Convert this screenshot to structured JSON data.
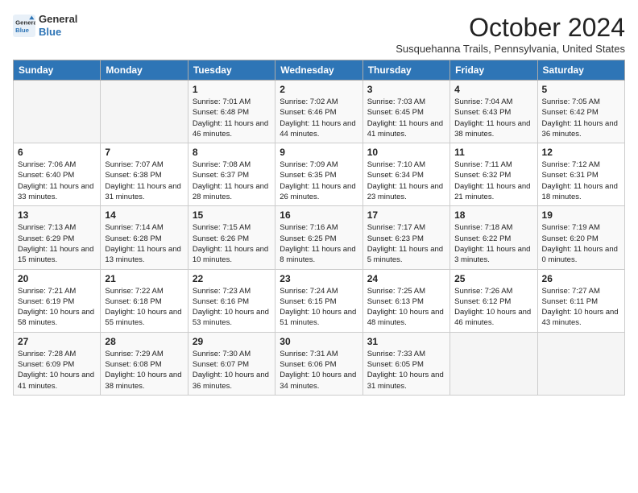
{
  "logo": {
    "line1": "General",
    "line2": "Blue"
  },
  "title": "October 2024",
  "subtitle": "Susquehanna Trails, Pennsylvania, United States",
  "days_of_week": [
    "Sunday",
    "Monday",
    "Tuesday",
    "Wednesday",
    "Thursday",
    "Friday",
    "Saturday"
  ],
  "weeks": [
    [
      {
        "day": "",
        "info": ""
      },
      {
        "day": "",
        "info": ""
      },
      {
        "day": "1",
        "info": "Sunrise: 7:01 AM\nSunset: 6:48 PM\nDaylight: 11 hours and 46 minutes."
      },
      {
        "day": "2",
        "info": "Sunrise: 7:02 AM\nSunset: 6:46 PM\nDaylight: 11 hours and 44 minutes."
      },
      {
        "day": "3",
        "info": "Sunrise: 7:03 AM\nSunset: 6:45 PM\nDaylight: 11 hours and 41 minutes."
      },
      {
        "day": "4",
        "info": "Sunrise: 7:04 AM\nSunset: 6:43 PM\nDaylight: 11 hours and 38 minutes."
      },
      {
        "day": "5",
        "info": "Sunrise: 7:05 AM\nSunset: 6:42 PM\nDaylight: 11 hours and 36 minutes."
      }
    ],
    [
      {
        "day": "6",
        "info": "Sunrise: 7:06 AM\nSunset: 6:40 PM\nDaylight: 11 hours and 33 minutes."
      },
      {
        "day": "7",
        "info": "Sunrise: 7:07 AM\nSunset: 6:38 PM\nDaylight: 11 hours and 31 minutes."
      },
      {
        "day": "8",
        "info": "Sunrise: 7:08 AM\nSunset: 6:37 PM\nDaylight: 11 hours and 28 minutes."
      },
      {
        "day": "9",
        "info": "Sunrise: 7:09 AM\nSunset: 6:35 PM\nDaylight: 11 hours and 26 minutes."
      },
      {
        "day": "10",
        "info": "Sunrise: 7:10 AM\nSunset: 6:34 PM\nDaylight: 11 hours and 23 minutes."
      },
      {
        "day": "11",
        "info": "Sunrise: 7:11 AM\nSunset: 6:32 PM\nDaylight: 11 hours and 21 minutes."
      },
      {
        "day": "12",
        "info": "Sunrise: 7:12 AM\nSunset: 6:31 PM\nDaylight: 11 hours and 18 minutes."
      }
    ],
    [
      {
        "day": "13",
        "info": "Sunrise: 7:13 AM\nSunset: 6:29 PM\nDaylight: 11 hours and 15 minutes."
      },
      {
        "day": "14",
        "info": "Sunrise: 7:14 AM\nSunset: 6:28 PM\nDaylight: 11 hours and 13 minutes."
      },
      {
        "day": "15",
        "info": "Sunrise: 7:15 AM\nSunset: 6:26 PM\nDaylight: 11 hours and 10 minutes."
      },
      {
        "day": "16",
        "info": "Sunrise: 7:16 AM\nSunset: 6:25 PM\nDaylight: 11 hours and 8 minutes."
      },
      {
        "day": "17",
        "info": "Sunrise: 7:17 AM\nSunset: 6:23 PM\nDaylight: 11 hours and 5 minutes."
      },
      {
        "day": "18",
        "info": "Sunrise: 7:18 AM\nSunset: 6:22 PM\nDaylight: 11 hours and 3 minutes."
      },
      {
        "day": "19",
        "info": "Sunrise: 7:19 AM\nSunset: 6:20 PM\nDaylight: 11 hours and 0 minutes."
      }
    ],
    [
      {
        "day": "20",
        "info": "Sunrise: 7:21 AM\nSunset: 6:19 PM\nDaylight: 10 hours and 58 minutes."
      },
      {
        "day": "21",
        "info": "Sunrise: 7:22 AM\nSunset: 6:18 PM\nDaylight: 10 hours and 55 minutes."
      },
      {
        "day": "22",
        "info": "Sunrise: 7:23 AM\nSunset: 6:16 PM\nDaylight: 10 hours and 53 minutes."
      },
      {
        "day": "23",
        "info": "Sunrise: 7:24 AM\nSunset: 6:15 PM\nDaylight: 10 hours and 51 minutes."
      },
      {
        "day": "24",
        "info": "Sunrise: 7:25 AM\nSunset: 6:13 PM\nDaylight: 10 hours and 48 minutes."
      },
      {
        "day": "25",
        "info": "Sunrise: 7:26 AM\nSunset: 6:12 PM\nDaylight: 10 hours and 46 minutes."
      },
      {
        "day": "26",
        "info": "Sunrise: 7:27 AM\nSunset: 6:11 PM\nDaylight: 10 hours and 43 minutes."
      }
    ],
    [
      {
        "day": "27",
        "info": "Sunrise: 7:28 AM\nSunset: 6:09 PM\nDaylight: 10 hours and 41 minutes."
      },
      {
        "day": "28",
        "info": "Sunrise: 7:29 AM\nSunset: 6:08 PM\nDaylight: 10 hours and 38 minutes."
      },
      {
        "day": "29",
        "info": "Sunrise: 7:30 AM\nSunset: 6:07 PM\nDaylight: 10 hours and 36 minutes."
      },
      {
        "day": "30",
        "info": "Sunrise: 7:31 AM\nSunset: 6:06 PM\nDaylight: 10 hours and 34 minutes."
      },
      {
        "day": "31",
        "info": "Sunrise: 7:33 AM\nSunset: 6:05 PM\nDaylight: 10 hours and 31 minutes."
      },
      {
        "day": "",
        "info": ""
      },
      {
        "day": "",
        "info": ""
      }
    ]
  ]
}
